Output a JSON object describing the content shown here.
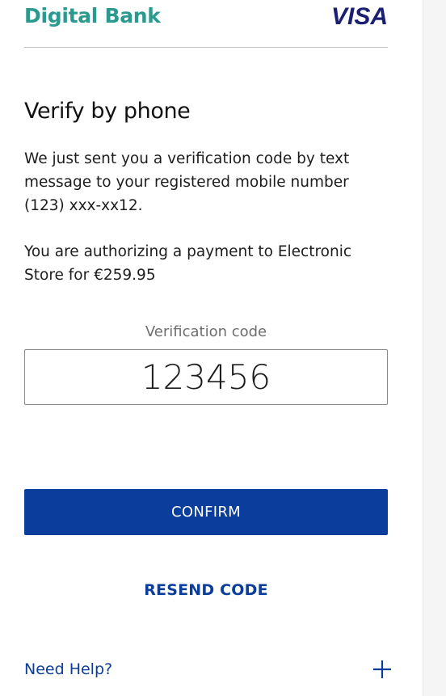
{
  "header": {
    "bank_name": "Digital Bank",
    "card_brand": "VISA"
  },
  "main": {
    "title": "Verify by phone",
    "paragraph_sent": "We just sent you a verification code by text message to your registered mobile number (123) xxx-xx12.",
    "paragraph_payment": "You are authorizing a payment to Electronic Store for €259.95",
    "code_label": "Verification code",
    "code_value": "123456",
    "confirm_label": "CONFIRM",
    "resend_label": "RESEND CODE"
  },
  "footer": {
    "help_label": "Need Help?",
    "help_icon": "plus-icon"
  },
  "colors": {
    "bank_teal": "#2a9a8e",
    "visa_navy": "#1a1f71",
    "primary_blue": "#0a3d9c"
  }
}
